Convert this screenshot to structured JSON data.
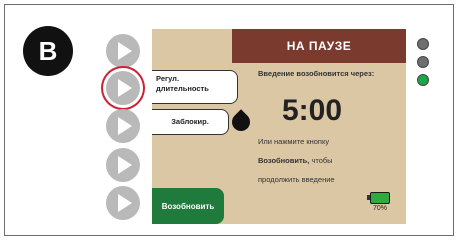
{
  "badge": "B",
  "screen": {
    "header": "НА ПАУЗЕ",
    "softkeys": {
      "duration": "Регул. длительность",
      "lock": "Заблокир."
    },
    "resume_notice": "Введение возобновится через:",
    "timer": "5:00",
    "hint_line1": "Или нажмите кнопку",
    "hint_bold": "Возобновить,",
    "hint_line2_rest": " чтобы",
    "hint_line3": "продолжить введение",
    "resume_button": "Возобновить",
    "battery_percent": "70%"
  },
  "side_buttons": [
    {
      "icon": "play-icon",
      "highlighted": false
    },
    {
      "icon": "play-icon",
      "highlighted": true
    },
    {
      "icon": "play-icon",
      "highlighted": false
    },
    {
      "icon": "play-icon",
      "highlighted": false
    },
    {
      "icon": "play-icon",
      "highlighted": false
    }
  ],
  "indicators": {
    "colors": [
      "#6f6f6f",
      "#6f6f6f",
      "#1aa64a"
    ]
  },
  "colors": {
    "header_bg": "#7a3b2e",
    "screen_bg": "#dcc7a5",
    "resume_bg": "#1f7b3c",
    "highlight_ring": "#cc2233"
  }
}
